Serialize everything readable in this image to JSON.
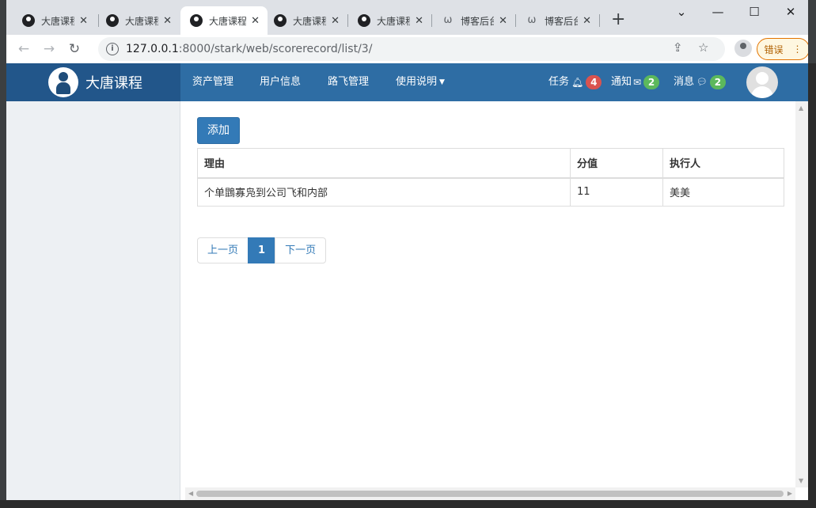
{
  "browser": {
    "tabs": [
      {
        "title": "大唐课程",
        "icon": "person-avatar-icon",
        "active": false
      },
      {
        "title": "大唐课程",
        "icon": "person-avatar-icon",
        "active": false
      },
      {
        "title": "大唐课程",
        "icon": "person-avatar-icon",
        "active": true
      },
      {
        "title": "大唐课程",
        "icon": "person-avatar-icon",
        "active": false
      },
      {
        "title": "大唐课程",
        "icon": "person-avatar-icon",
        "active": false
      },
      {
        "title": "博客后台",
        "icon": "blog-icon",
        "active": false
      },
      {
        "title": "博客后台",
        "icon": "blog-icon",
        "active": false
      }
    ],
    "url_host": "127.0.0.1",
    "url_path": ":8000/stark/web/scorerecord/list/3/",
    "error_button": "错误"
  },
  "header": {
    "brand": "大唐课程",
    "menu": [
      "资产管理",
      "用户信息",
      "路飞管理",
      "使用说明"
    ],
    "tasks": {
      "label": "任务",
      "count": "4"
    },
    "notices": {
      "label": "通知",
      "count": "2"
    },
    "messages": {
      "label": "消息",
      "count": "2"
    }
  },
  "main": {
    "add_button": "添加",
    "table": {
      "headers": [
        "理由",
        "分值",
        "执行人"
      ],
      "rows": [
        {
          "reason": "个单鵾寡凫到公司飞和内部",
          "score": "11",
          "executor": "美美"
        }
      ]
    },
    "pagination": {
      "prev": "上一页",
      "current": "1",
      "next": "下一页"
    }
  },
  "colors": {
    "primary": "#337ab7",
    "header": "#2e6da4",
    "brand_bg": "#22568a",
    "badge_red": "#d9534f",
    "badge_green": "#5cb85c"
  }
}
